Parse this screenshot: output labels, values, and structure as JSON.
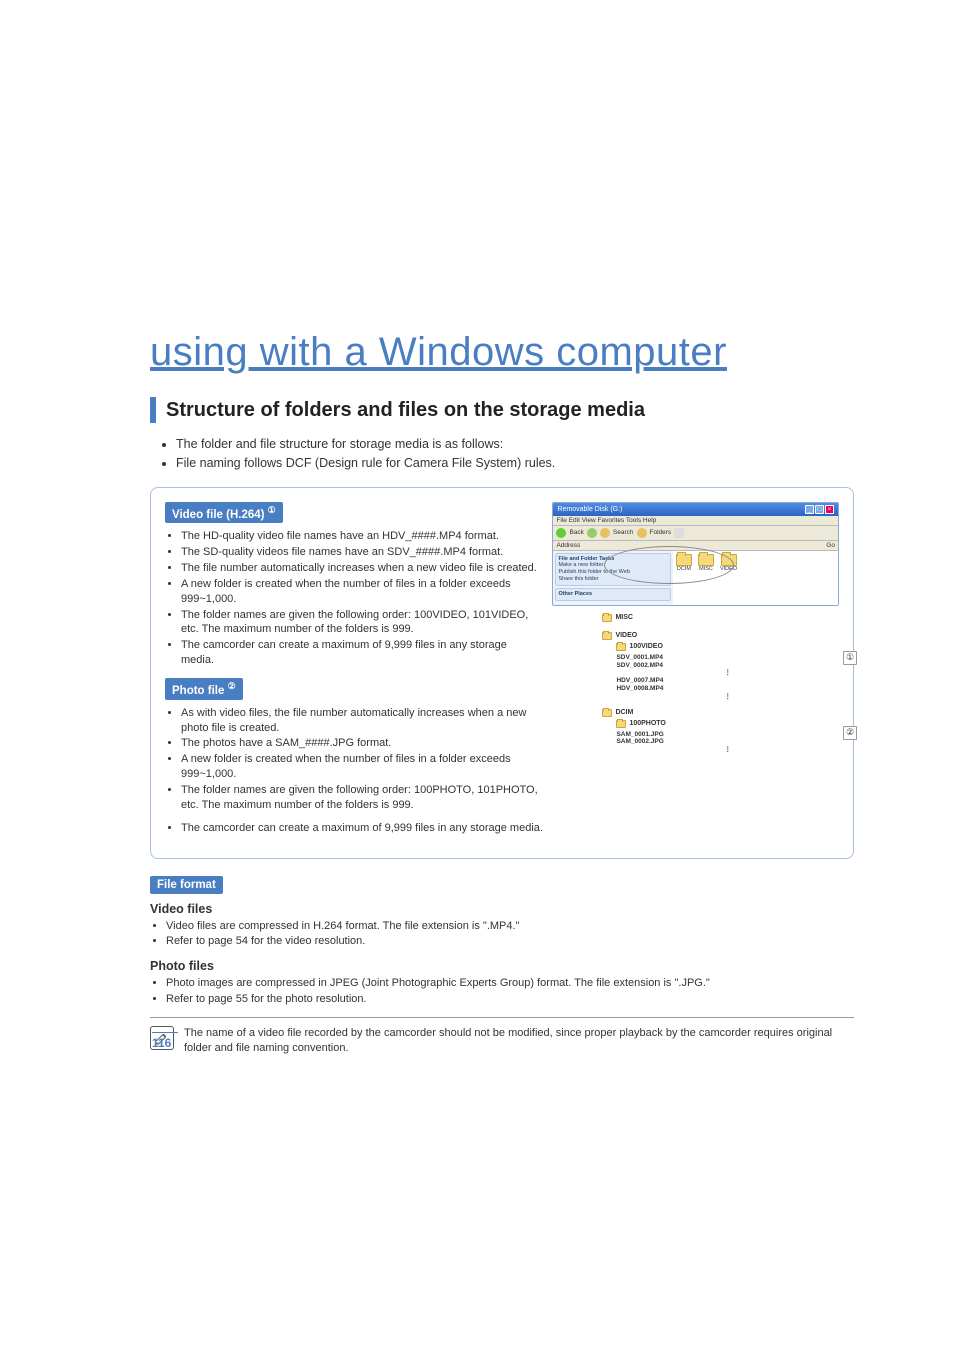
{
  "chapter_title": "using with a Windows computer",
  "section_title": "Structure of folders and files on the storage media",
  "intro_bullets": [
    "The folder and file structure for storage media is as follows:",
    "File naming follows DCF (Design rule for Camera File System) rules."
  ],
  "video_tag": "Video file (H.264)",
  "video_tag_sup": "①",
  "video_bullets": [
    "The HD-quality video file names have an HDV_####.MP4 format.",
    "The SD-quality videos file names have an SDV_####.MP4 format.",
    "The file number automatically increases when a new video file is created.",
    "A new folder is created when the number of files in a folder exceeds 999~1,000.",
    "The folder names are given the following order: 100VIDEO, 101VIDEO, etc. The maximum number of the folders is 999.",
    "The camcorder can create a maximum of 9,999 files in any storage media."
  ],
  "photo_tag": "Photo file",
  "photo_tag_sup": "②",
  "photo_bullets": [
    "As with video files, the file number automatically increases when a new photo file is created.",
    "The photos have a SAM_####.JPG format.",
    "A new folder is created when the number of files in a folder exceeds 999~1,000.",
    "The folder names are given the following order: 100PHOTO, 101PHOTO, etc. The maximum number of the folders is 999.",
    "The camcorder can create a maximum of 9,999 files in any storage media."
  ],
  "file_format_tag": "File format",
  "video_files_head": "Video files",
  "video_files_bullets": [
    "Video files are compressed in H.264 format. The file extension is \".MP4.\"",
    "Refer to page 54 for the video resolution."
  ],
  "photo_files_head": "Photo files",
  "photo_files_bullets": [
    "Photo images are compressed in JPEG (Joint Photographic Experts Group) format. The file extension is \".JPG.\"",
    "Refer to page 55 for the photo resolution."
  ],
  "note_text": "The name of a video file recorded by the camcorder should not be modified, since proper playback by the camcorder requires original folder and file naming convention.",
  "page_number": "116",
  "explorer": {
    "title": "Removable Disk (G:)",
    "menu": "File  Edit  View  Favorites  Tools  Help",
    "toolbar": {
      "back": "Back",
      "search": "Search",
      "folders": "Folders"
    },
    "address_label": "Address",
    "go": "Go",
    "side_panel_title": "File and Folder Tasks",
    "side_items": [
      "Make a new folder",
      "Publish this folder to the Web",
      "Share this folder"
    ],
    "side_panel2": "Other Places",
    "main_folders": [
      "DCIM",
      "MISC",
      "VIDEO"
    ]
  },
  "tree": {
    "misc": "MISC",
    "video": "VIDEO",
    "video_sub": "100VIDEO",
    "video_files": [
      "SDV_0001.MP4",
      "SDV_0002.MP4"
    ],
    "video_files2": [
      "HDV_0007.MP4",
      "HDV_0008.MP4"
    ],
    "dcim": "DCIM",
    "dcim_sub": "100PHOTO",
    "dcim_files": [
      "SAM_0001.JPG",
      "SAM_0002.JPG"
    ],
    "badge1": "①",
    "badge2": "②"
  }
}
